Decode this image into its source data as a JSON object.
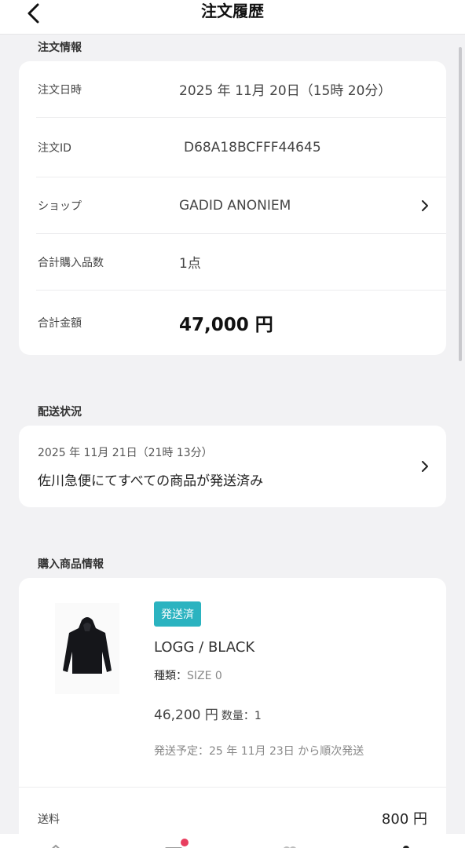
{
  "header": {
    "title": "注文履歴",
    "back_icon": "chevron-left-icon"
  },
  "order_info": {
    "section_label": "注文情報",
    "rows": [
      {
        "label": "注文日時",
        "value": "2025 年 11月 20日（15時 20分）"
      },
      {
        "label": "注文ID",
        "value": "D68A18BCFFF44645"
      },
      {
        "label": "ショップ",
        "value": "GADID ANONIEM"
      },
      {
        "label": "合計購入品数",
        "value": "1点"
      },
      {
        "label": "合計金額",
        "value": "47,000 円"
      }
    ]
  },
  "delivery": {
    "section_label": "配送状況",
    "date": "2025 年 11月 21日（21時 13分）",
    "status": "佐川急便にてすべての商品が発送済み"
  },
  "purchased": {
    "section_label": "購入商品情報",
    "badge": "発送済",
    "badge_color": "#2bb3c0",
    "product_name": "LOGG / BLACK",
    "variant_label": "種類：",
    "variant_value": "SIZE 0",
    "price": "46,200 円",
    "qty": "数量：1",
    "eta": "発送予定：25 年 11月 23日 から順次発送",
    "shipping_label": "送料",
    "shipping_value": "800 円"
  },
  "tabbar": {
    "icons": [
      "home-icon",
      "cart-icon",
      "heart-icon",
      "user-icon"
    ],
    "notification_color": "#e83e5f"
  }
}
